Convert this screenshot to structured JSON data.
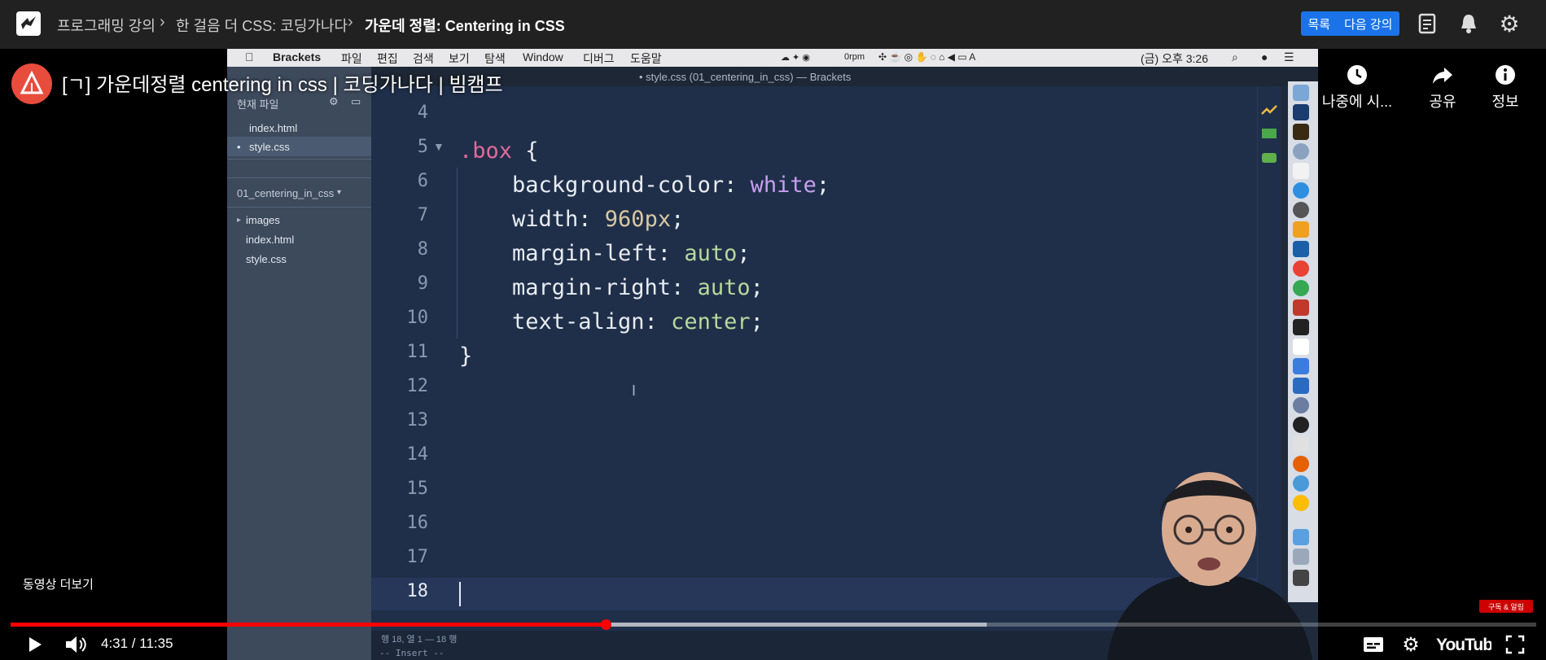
{
  "topbar": {
    "breadcrumbs": [
      "프로그래밍 강의",
      "한 걸음 더 CSS: 코딩가나다",
      "가운데 정렬: Centering in CSS"
    ],
    "list_label": "목록",
    "next_label": "다음 강의"
  },
  "video": {
    "title": "[ㄱ] 가운데정렬 centering in css | 코딩가나다 | 빔캠프",
    "watch_later": "나중에 시...",
    "share": "공유",
    "info": "정보",
    "more_videos": "동영상 더보기",
    "time": "4:31 / 11:35",
    "progress_fraction": 0.39,
    "buffered_fraction": 0.64,
    "badge": "구독 & 알림"
  },
  "mac": {
    "app": "Brackets",
    "menus": [
      "파일",
      "편집",
      "검색",
      "보기",
      "탐색",
      "Window",
      "디버그",
      "도움말"
    ],
    "rpm": "0rpm",
    "clock": "(금) 오후 3:26"
  },
  "editor": {
    "window_title": "• style.css (01_centering_in_css) — Brackets",
    "working_files_label": "현재 파일",
    "working_files": [
      "index.html",
      "style.css"
    ],
    "project": "01_centering_in_css",
    "tree": [
      "images",
      "index.html",
      "style.css"
    ],
    "line_numbers": [
      "4",
      "5",
      "6",
      "7",
      "8",
      "9",
      "10",
      "11",
      "12",
      "13",
      "14",
      "15",
      "16",
      "17",
      "18"
    ],
    "code": {
      "l5_sel": ".box",
      "l5_brace": " {",
      "l6_prop": "background-color: ",
      "l6_val": "white",
      "l7_prop": "width: ",
      "l7_val": "960px",
      "l8_prop": "margin-left: ",
      "l8_val": "auto",
      "l9_prop": "margin-right: ",
      "l9_val": "auto",
      "l10_prop": "text-align: ",
      "l10_val": "center",
      "semi": ";",
      "l11": "}"
    },
    "status_line": "행 18, 열 1 — 18 행",
    "mode": "-- Insert --"
  },
  "colors": {
    "accent": "#1a73e8",
    "progress": "#ff0000",
    "editor_bg": "#1f2f4a",
    "selector": "#e26a9a"
  }
}
